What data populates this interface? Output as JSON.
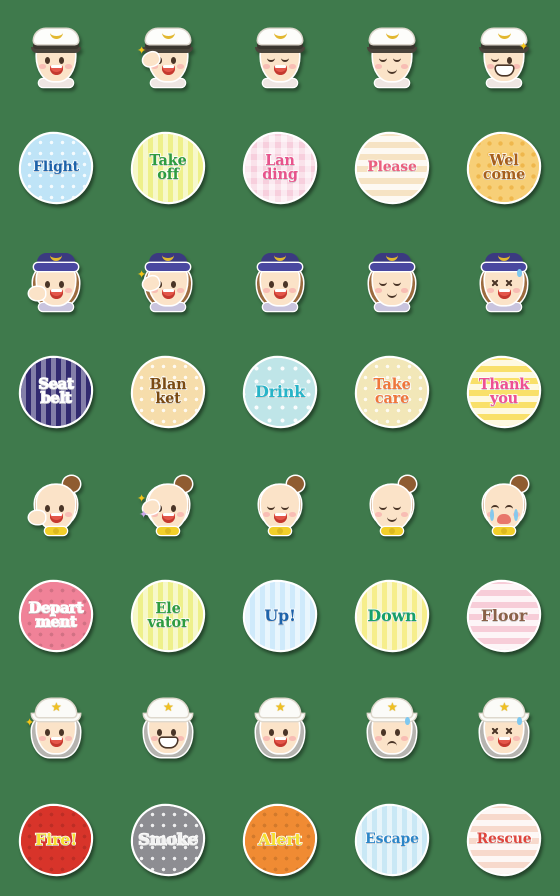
{
  "sheet": {
    "title": "Cabin Crew & Rescue Emoji Sticker Sheet",
    "background_color": "#3f7a4c",
    "columns": 5,
    "rows": 8
  },
  "rows": [
    {
      "index": 1,
      "kind": "face",
      "character": "pilot",
      "cells": [
        {
          "name": "pilot-smiling",
          "expression": "open smile"
        },
        {
          "name": "pilot-saluting",
          "expression": "salute with sparkle"
        },
        {
          "name": "pilot-laughing",
          "expression": "happy closed eyes"
        },
        {
          "name": "pilot-calm",
          "expression": "content closed eyes"
        },
        {
          "name": "pilot-winking",
          "expression": "wink and grin"
        }
      ]
    },
    {
      "index": 2,
      "kind": "badge",
      "cells": [
        {
          "name": "badge-flight",
          "lines": [
            "Flight"
          ],
          "text": "Flight",
          "bg": "#bfe4f7",
          "fg": "#1d63ab",
          "pattern": "dots"
        },
        {
          "name": "badge-take-off",
          "lines": [
            "Take",
            "off"
          ],
          "text": "Take off",
          "bg": "#eef08a",
          "fg": "#2e9c3f",
          "pattern": "vstripe"
        },
        {
          "name": "badge-landing",
          "lines": [
            "Lan",
            "ding"
          ],
          "text": "Landing",
          "bg": "#f7cfdd",
          "fg": "#e8538c",
          "pattern": "check"
        },
        {
          "name": "badge-please",
          "lines": [
            "Please"
          ],
          "text": "Please",
          "bg": "#f6e3c4",
          "fg": "#ec5f7e",
          "pattern": "hstripe"
        },
        {
          "name": "badge-welcome",
          "lines": [
            "Wel",
            "come"
          ],
          "text": "Welcome",
          "bg": "#f7cf77",
          "fg": "#a8601c",
          "pattern": "dots-warm"
        }
      ]
    },
    {
      "index": 3,
      "kind": "face",
      "character": "flight-attendant",
      "cells": [
        {
          "name": "attendant-welcoming",
          "expression": "smiling with hand gesture"
        },
        {
          "name": "attendant-pointing",
          "expression": "pointing with crown sparkle"
        },
        {
          "name": "attendant-cheerful",
          "expression": "open smile"
        },
        {
          "name": "attendant-calm",
          "expression": "gentle closed-eye smile"
        },
        {
          "name": "attendant-distressed",
          "expression": "X eyes with sweat drop"
        }
      ]
    },
    {
      "index": 4,
      "kind": "badge",
      "cells": [
        {
          "name": "badge-seat-belt",
          "lines": [
            "Seat",
            "belt"
          ],
          "text": "Seat belt",
          "bg": "#322a70",
          "fg": "#ffffff",
          "pattern": "vstripe-soft"
        },
        {
          "name": "badge-blanket",
          "lines": [
            "Blan",
            "ket"
          ],
          "text": "Blanket",
          "bg": "#f6ddab",
          "fg": "#7a4a12",
          "pattern": "dots"
        },
        {
          "name": "badge-drink",
          "lines": [
            "Drink"
          ],
          "text": "Drink",
          "bg": "#bfe5e8",
          "fg": "#27b4c8",
          "pattern": "stars"
        },
        {
          "name": "badge-take-care",
          "lines": [
            "Take",
            "care"
          ],
          "text": "Take care",
          "bg": "#f2e7b8",
          "fg": "#f0763a",
          "pattern": "dots"
        },
        {
          "name": "badge-thank-you",
          "lines": [
            "Thank",
            "you"
          ],
          "text": "Thank you",
          "bg": "#f9e06a",
          "fg": "#ef4f92",
          "pattern": "hstripe"
        }
      ]
    },
    {
      "index": 5,
      "kind": "face",
      "character": "elevator-attendant",
      "cells": [
        {
          "name": "usher-guiding",
          "expression": "open-hand guiding gesture"
        },
        {
          "name": "usher-announcing",
          "expression": "pointing up with sparkles"
        },
        {
          "name": "usher-laughing",
          "expression": "laughing closed eyes"
        },
        {
          "name": "usher-bowing",
          "expression": "smiling bow"
        },
        {
          "name": "usher-crying",
          "expression": "crying with tears"
        }
      ]
    },
    {
      "index": 6,
      "kind": "badge",
      "cells": [
        {
          "name": "badge-department",
          "lines": [
            "Depart",
            "ment"
          ],
          "text": "Department",
          "bg": "#f08298",
          "fg": "#ffffff",
          "pattern": "dots-dark"
        },
        {
          "name": "badge-elevator",
          "lines": [
            "Ele",
            "vator"
          ],
          "text": "Elevator",
          "bg": "#eef08a",
          "fg": "#2e9c3f",
          "pattern": "vstripe"
        },
        {
          "name": "badge-up",
          "lines": [
            "Up!"
          ],
          "text": "Up!",
          "bg": "#cfeafb",
          "fg": "#1d63ab",
          "pattern": "vstripe"
        },
        {
          "name": "badge-down",
          "lines": [
            "Down"
          ],
          "text": "Down",
          "bg": "#f6ee8c",
          "fg": "#16a06a",
          "pattern": "vstripe"
        },
        {
          "name": "badge-floor",
          "lines": [
            "Floor"
          ],
          "text": "Floor",
          "bg": "#f7cdd8",
          "fg": "#8a6048",
          "pattern": "hstripe"
        }
      ]
    },
    {
      "index": 7,
      "kind": "face",
      "character": "firefighter",
      "cells": [
        {
          "name": "firefighter-cheerful",
          "expression": "happy with sparkle"
        },
        {
          "name": "firefighter-grinning",
          "expression": "grin with blush mark"
        },
        {
          "name": "firefighter-alert",
          "expression": "open mouth alert"
        },
        {
          "name": "firefighter-worried",
          "expression": "worried frown with sweat"
        },
        {
          "name": "firefighter-panicked",
          "expression": "panicked shouting with sweat"
        }
      ]
    },
    {
      "index": 8,
      "kind": "badge",
      "cells": [
        {
          "name": "badge-fire",
          "lines": [
            "Fire!"
          ],
          "text": "Fire!",
          "bg": "#d8342a",
          "fg": "#f7e02f",
          "pattern": "dots-dark"
        },
        {
          "name": "badge-smoke",
          "lines": [
            "Smoke"
          ],
          "text": "Smoke",
          "bg": "#8d8d92",
          "fg": "#f2f2f2",
          "pattern": "dots"
        },
        {
          "name": "badge-alert",
          "lines": [
            "Alert"
          ],
          "text": "Alert",
          "bg": "#f08b33",
          "fg": "#f7e02f",
          "pattern": "dots-dark"
        },
        {
          "name": "badge-escape",
          "lines": [
            "Escape"
          ],
          "text": "Escape",
          "bg": "#c9e8f5",
          "fg": "#2b86c9",
          "pattern": "vstripe"
        },
        {
          "name": "badge-rescue",
          "lines": [
            "Rescue"
          ],
          "text": "Rescue",
          "bg": "#f7d9cc",
          "fg": "#e0453c",
          "pattern": "hstripe"
        }
      ]
    }
  ]
}
